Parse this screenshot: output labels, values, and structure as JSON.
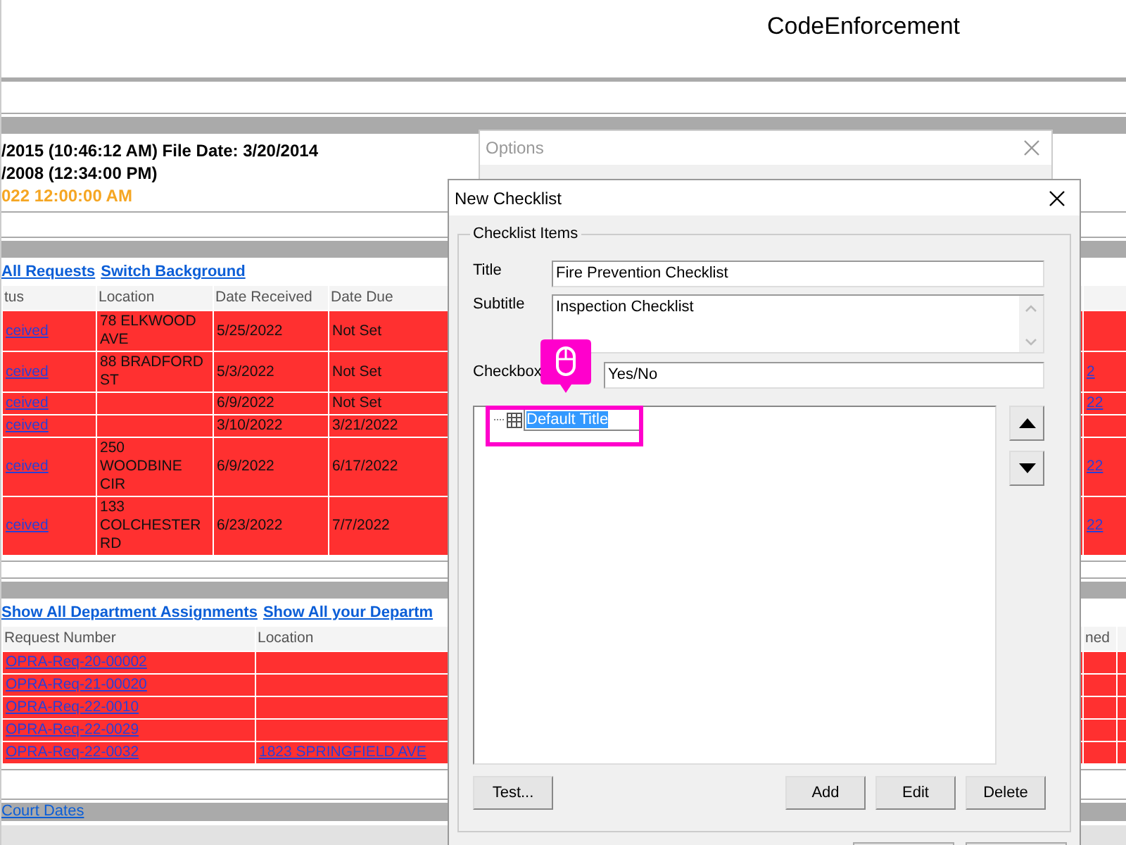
{
  "header": {
    "app_title": "CodeEnforcement"
  },
  "info": {
    "lines": [
      {
        "text": "/2015 (10:46:12 AM) File Date: 3/20/2014",
        "kind": "plain"
      },
      {
        "text": "/2008 (12:34:00 PM)",
        "kind": "plain"
      },
      {
        "text": "022 12:00:00 AM",
        "kind": "alert"
      }
    ]
  },
  "requests": {
    "links": [
      "All Requests",
      "Switch Background"
    ],
    "columns": [
      "tus",
      "Location",
      "Date Received",
      "Date Due"
    ],
    "rows": [
      {
        "status": "ceived",
        "location": "78 ELKWOOD AVE",
        "received": "5/25/2022",
        "due": "Not Set"
      },
      {
        "status": "ceived",
        "location": "88 BRADFORD ST",
        "received": "5/3/2022",
        "due": "Not Set",
        "column_5": "2"
      },
      {
        "status": "ceived",
        "received": "6/9/2022",
        "due": "Not Set",
        "column_5": "22"
      },
      {
        "status": "ceived",
        "received": "3/10/2022",
        "due": "3/21/2022"
      },
      {
        "status": "ceived",
        "location": "250 WOODBINE CIR",
        "received": "6/9/2022",
        "due": "6/17/2022",
        "column_5": "22"
      },
      {
        "status": "ceived",
        "location": "133 COLCHESTER RD",
        "received": "6/23/2022",
        "due": "7/7/2022",
        "column_5": "22"
      }
    ]
  },
  "assignments": {
    "links": [
      "Show All Department Assignments",
      "Show All your Departm"
    ],
    "columns": [
      "Request Number",
      "Location",
      "ned"
    ],
    "rows": [
      {
        "request_number": "OPRA-Req-20-00002"
      },
      {
        "request_number": "OPRA-Req-21-00020"
      },
      {
        "request_number": "OPRA-Req-22-0010"
      },
      {
        "request_number": "OPRA-Req-22-0029"
      },
      {
        "request_number": "OPRA-Req-22-0032",
        "location": "1823 SPRINGFIELD AVE"
      }
    ]
  },
  "court_dates": {
    "link": "Court Dates"
  },
  "options_window": {
    "title": "Options"
  },
  "checklist_dialog": {
    "title": "New Checklist",
    "group_label": "Checklist Items",
    "fields": [
      {
        "label": "Title",
        "value": "Fire Prevention Checklist",
        "kind": "text"
      },
      {
        "label": "Subtitle",
        "value": "Inspection Checklist",
        "kind": "multiline"
      },
      {
        "label": "Checkbox",
        "value": "Yes/No",
        "kind": "checkbox"
      }
    ],
    "tree": [
      {
        "label": "Default Title",
        "selected": true
      }
    ],
    "buttons": [
      "Test...",
      "Add",
      "Edit",
      "Delete"
    ]
  }
}
